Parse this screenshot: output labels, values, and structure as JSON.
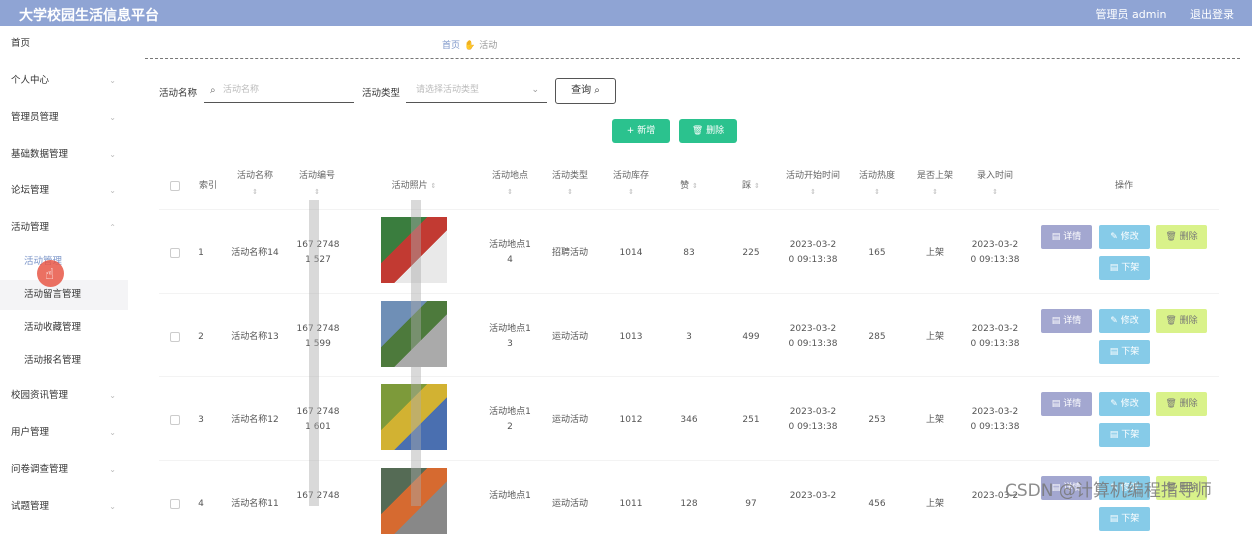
{
  "header": {
    "title": "大学校园生活信息平台",
    "admin_label": "管理员 admin",
    "logout_label": "退出登录"
  },
  "sidebar": {
    "items": [
      {
        "label": "首页",
        "has_chevron": false
      },
      {
        "label": "个人中心",
        "has_chevron": true
      },
      {
        "label": "管理员管理",
        "has_chevron": true
      },
      {
        "label": "基础数据管理",
        "has_chevron": true
      },
      {
        "label": "论坛管理",
        "has_chevron": true
      },
      {
        "label": "活动管理",
        "has_chevron": true
      }
    ],
    "sub_items": [
      "活动管理",
      "活动留言管理",
      "活动收藏管理",
      "活动报名管理"
    ],
    "items_after": [
      {
        "label": "校园资讯管理",
        "has_chevron": true
      },
      {
        "label": "用户管理",
        "has_chevron": true
      },
      {
        "label": "问卷调查管理",
        "has_chevron": true
      },
      {
        "label": "试题管理",
        "has_chevron": true
      }
    ]
  },
  "breadcrumb": {
    "home": "首页",
    "current": "活动"
  },
  "search": {
    "name_label": "活动名称",
    "name_placeholder": "活动名称",
    "type_label": "活动类型",
    "type_placeholder": "请选择活动类型",
    "query_label": "查询"
  },
  "actions": {
    "add_label": "新增",
    "delete_label": "删除"
  },
  "table": {
    "headers": [
      "索引",
      "活动名称",
      "活动编号",
      "活动照片",
      "活动地点",
      "活动类型",
      "活动库存",
      "赞",
      "踩",
      "活动开始时间",
      "活动热度",
      "是否上架",
      "录入时间",
      "操作"
    ],
    "rows": [
      {
        "index": "1",
        "name": "活动名称14",
        "code_a": "167 2748",
        "code_b": "1 527",
        "place_a": "活动地点1",
        "place_b": "4",
        "type": "招聘活动",
        "stock": "1014",
        "like": "83",
        "dislike": "225",
        "start_a": "2023-03-2",
        "start_b": "0 09:13:38",
        "heat": "165",
        "shelf": "上架",
        "created_a": "2023-03-2",
        "created_b": "0 09:13:38"
      },
      {
        "index": "2",
        "name": "活动名称13",
        "code_a": "167 2748",
        "code_b": "1 599",
        "place_a": "活动地点1",
        "place_b": "3",
        "type": "运动活动",
        "stock": "1013",
        "like": "3",
        "dislike": "499",
        "start_a": "2023-03-2",
        "start_b": "0 09:13:38",
        "heat": "285",
        "shelf": "上架",
        "created_a": "2023-03-2",
        "created_b": "0 09:13:38"
      },
      {
        "index": "3",
        "name": "活动名称12",
        "code_a": "167 2748",
        "code_b": "1 601",
        "place_a": "活动地点1",
        "place_b": "2",
        "type": "运动活动",
        "stock": "1012",
        "like": "346",
        "dislike": "251",
        "start_a": "2023-03-2",
        "start_b": "0 09:13:38",
        "heat": "253",
        "shelf": "上架",
        "created_a": "2023-03-2",
        "created_b": "0 09:13:38"
      },
      {
        "index": "4",
        "name": "活动名称11",
        "code_a": "167 2748",
        "code_b": "",
        "place_a": "活动地点1",
        "place_b": "",
        "type": "运动活动",
        "stock": "1011",
        "like": "128",
        "dislike": "97",
        "start_a": "2023-03-2",
        "start_b": "",
        "heat": "456",
        "shelf": "上架",
        "created_a": "2023-03-2",
        "created_b": ""
      }
    ],
    "row_buttons": {
      "detail": "详情",
      "edit": "修改",
      "delete": "删除",
      "down": "下架"
    }
  },
  "watermark": "CSDN @计算机编程指导师",
  "colors": {
    "header_bg": "#8fa4d4",
    "accent_green": "#2bc28e",
    "link_blue": "#7b95c9"
  }
}
